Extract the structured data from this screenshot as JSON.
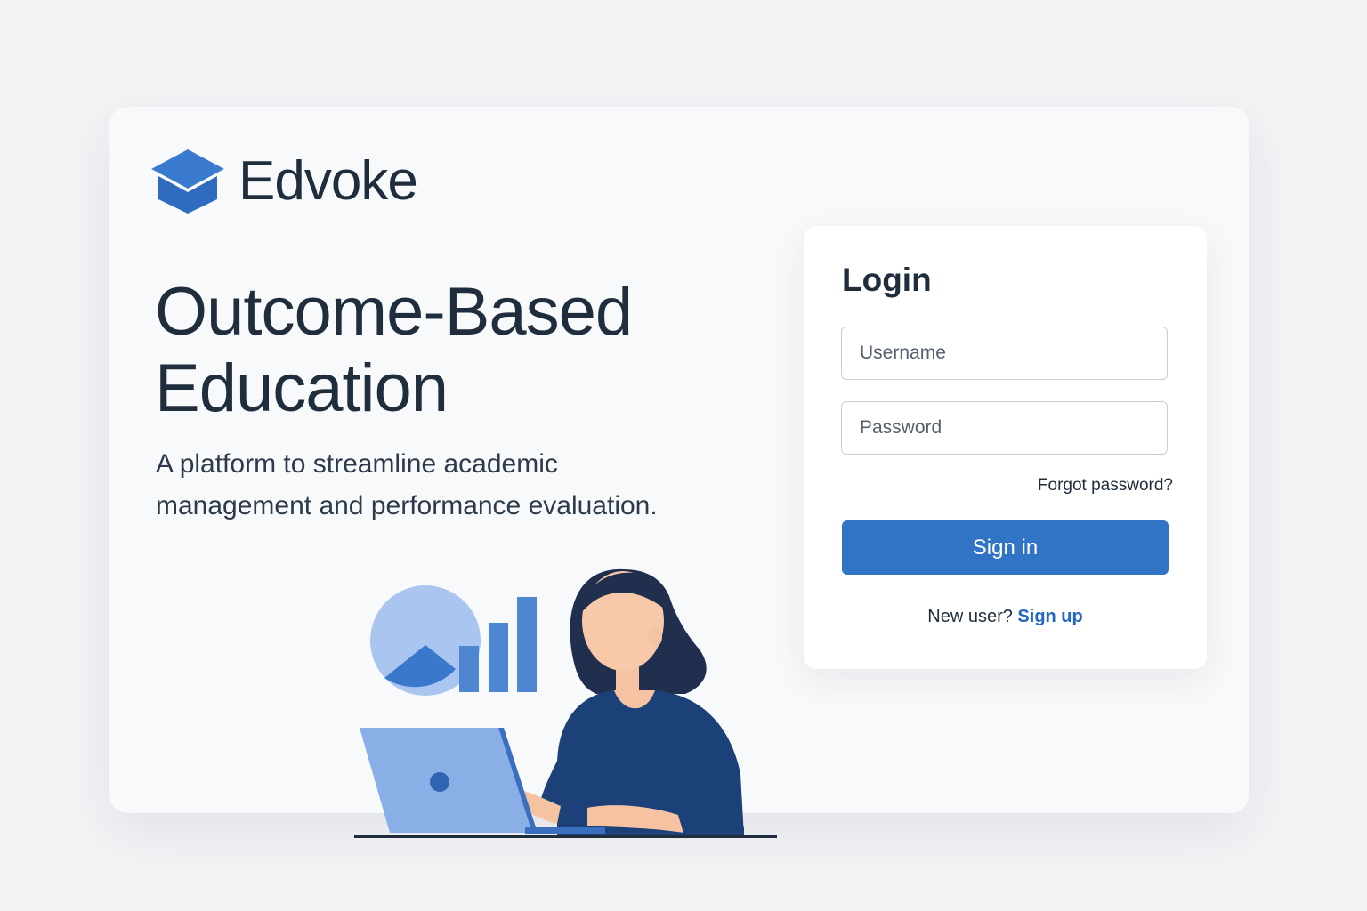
{
  "brand": {
    "name": "Edvoke",
    "icon": "graduation-cap-icon"
  },
  "hero": {
    "title_line1": "Outcome-Based",
    "title_line2": "Education",
    "subtitle_line1": "A platform to streamline academic",
    "subtitle_line2": "management and performance evaluation."
  },
  "login": {
    "title": "Login",
    "username_placeholder": "Username",
    "password_placeholder": "Password",
    "forgot_label": "Forgot password?",
    "signin_label": "Sign in",
    "new_user_text": "New user?",
    "signup_label": "Sign up"
  },
  "colors": {
    "accent": "#3174c6",
    "link": "#2167c4",
    "text_dark": "#1f2d3d",
    "background": "#f2f3f5",
    "card": "#f8f9fa",
    "illustration_navy": "#1c4179",
    "illustration_light_blue": "#aac6f0",
    "illustration_mid_blue": "#4f86d2"
  }
}
